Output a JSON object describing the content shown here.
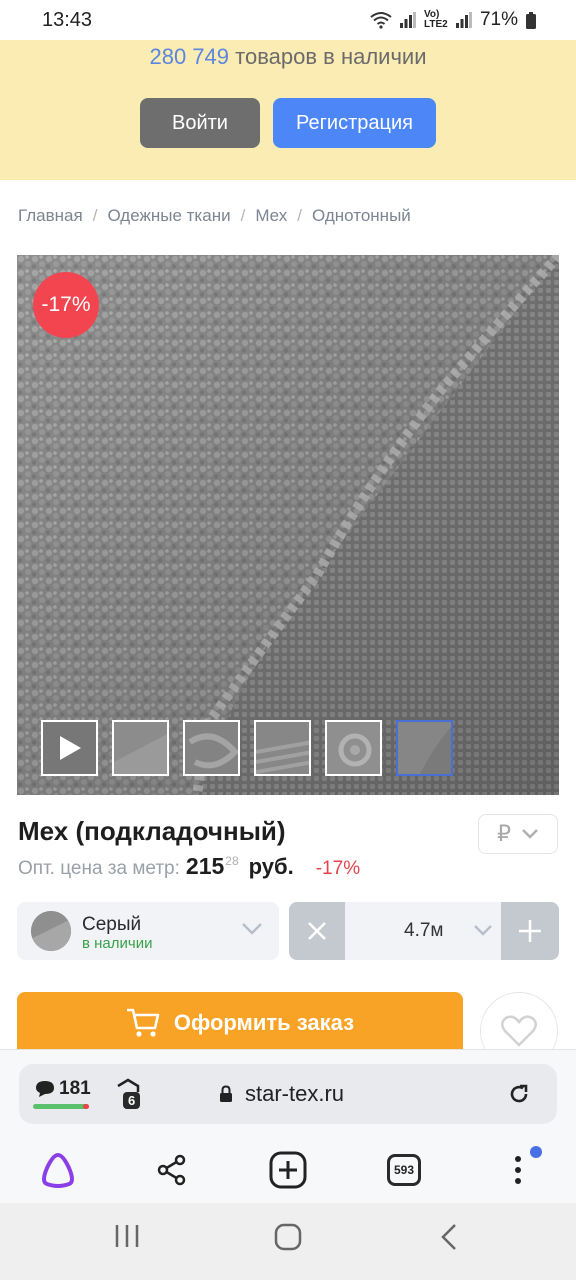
{
  "status_bar": {
    "time": "13:43",
    "network": "Vo) LTE2",
    "battery": "71%"
  },
  "banner": {
    "count": "280 749",
    "text": "товаров в наличии",
    "login_label": "Войти",
    "register_label": "Регистрация"
  },
  "breadcrumb": [
    "Главная",
    "Одежные ткани",
    "Мех",
    "Однотонный"
  ],
  "gallery": {
    "discount_badge": "-17%",
    "thumbnail_count": 6,
    "active_thumbnail": 5
  },
  "product": {
    "title": "Мех (подкладочный)",
    "price_label": "Опт. цена за метр:",
    "price_rub": "215",
    "price_kop": "28",
    "currency_unit": "руб.",
    "discount": "-17%",
    "currency_symbol": "₽"
  },
  "color_option": {
    "name": "Серый",
    "status": "в наличии"
  },
  "quantity": {
    "value": "4.7м"
  },
  "actions": {
    "order_label": "Оформить заказ"
  },
  "browser": {
    "comments_count": "181",
    "tabs_count": "6",
    "url": "star-tex.ru",
    "open_tabs": "593"
  },
  "colors": {
    "accent_blue": "#4d86f6",
    "order_orange": "#f9a326",
    "discount_red": "#f2454f",
    "in_stock_green": "#3aa14a",
    "banner_bg": "#fbecb4"
  }
}
